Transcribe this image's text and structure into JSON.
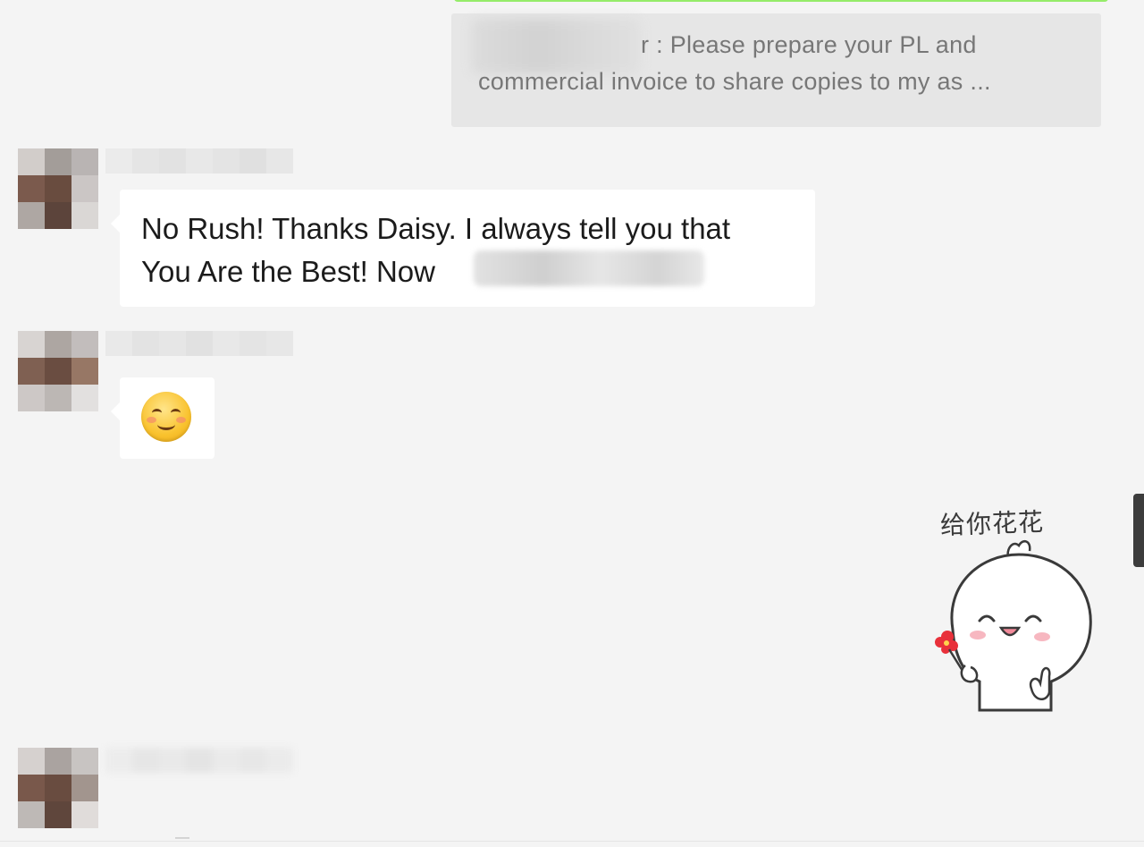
{
  "chat": {
    "quote": {
      "line1": "r : Please prepare your PL and",
      "line2": "commercial invoice to share copies to my as ..."
    },
    "messages": [
      {
        "direction": "incoming",
        "line1": "No Rush! Thanks Daisy. I always tell you that",
        "line2": "You Are the Best! Now"
      },
      {
        "direction": "incoming",
        "emoji": "smiling-face-icon"
      },
      {
        "direction": "outgoing",
        "sticker_caption": "给你花花",
        "sticker": "bunny-flower-sticker"
      }
    ],
    "bottom_mark": "—"
  },
  "colors": {
    "background": "#f4f4f4",
    "outgoing_bubble": "#95ec69",
    "incoming_bubble": "#ffffff",
    "quote_block": "#e6e6e6",
    "quote_text": "#777777",
    "scrollbar": "#3c3c3c"
  }
}
